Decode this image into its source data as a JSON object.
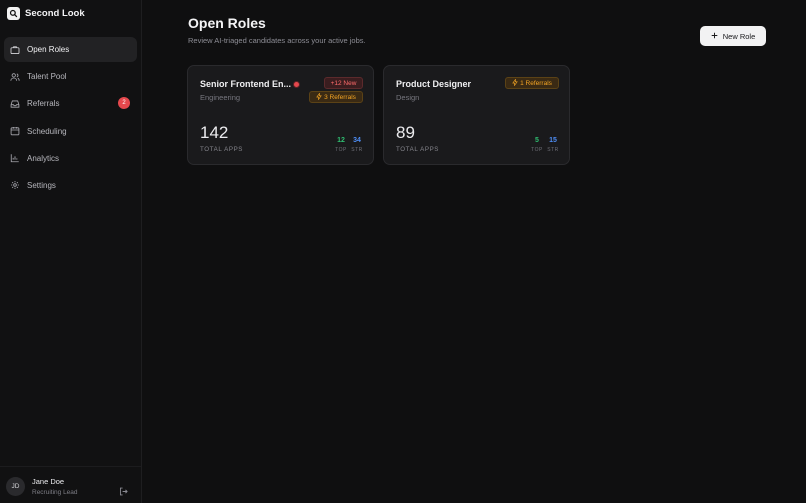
{
  "brand": {
    "name": "Second Look"
  },
  "sidebar": {
    "items": [
      {
        "label": "Open Roles",
        "icon": "briefcase-icon",
        "active": true
      },
      {
        "label": "Talent Pool",
        "icon": "users-icon"
      },
      {
        "label": "Referrals",
        "icon": "inbox-icon",
        "badge": "2"
      },
      {
        "label": "Scheduling",
        "icon": "calendar-icon"
      },
      {
        "label": "Analytics",
        "icon": "chart-icon"
      },
      {
        "label": "Settings",
        "icon": "gear-icon"
      }
    ]
  },
  "user": {
    "initials": "JD",
    "name": "Jane Doe",
    "role": "Recruiting Lead"
  },
  "header": {
    "title": "Open Roles",
    "subtitle": "Review AI-triaged candidates across your active jobs.",
    "new_button": "New Role"
  },
  "roles": [
    {
      "title": "Senior Frontend En...",
      "department": "Engineering",
      "new_badge": "+12 New",
      "referrals": "3 Referrals",
      "total": "142",
      "total_label": "TOTAL APPS",
      "top": "12",
      "top_label": "TOP",
      "str": "34",
      "str_label": "STR"
    },
    {
      "title": "Product Designer",
      "department": "Design",
      "referrals": "1 Referrals",
      "total": "89",
      "total_label": "TOTAL APPS",
      "top": "5",
      "top_label": "TOP",
      "str": "15",
      "str_label": "STR"
    }
  ],
  "colors": {
    "accent_red": "#e5484d",
    "referral_amber": "#f5a524",
    "top_green": "#2fbf71",
    "str_blue": "#4e8ef7"
  }
}
